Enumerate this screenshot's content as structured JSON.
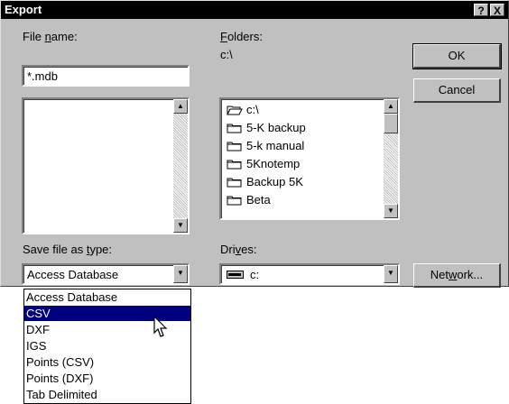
{
  "window": {
    "title": "Export",
    "help_glyph": "?",
    "close_glyph": "X"
  },
  "file_name": {
    "label_pre": "File ",
    "label_accel": "n",
    "label_post": "ame:",
    "value": "*.mdb"
  },
  "folders": {
    "label_accel": "F",
    "label_post": "olders:",
    "current_path": "c:\\",
    "items": [
      {
        "label": "c:\\",
        "icon": "open-folder-icon"
      },
      {
        "label": "5-K backup",
        "icon": "folder-icon"
      },
      {
        "label": "5-k manual",
        "icon": "folder-icon"
      },
      {
        "label": "5Knotemp",
        "icon": "folder-icon"
      },
      {
        "label": "Backup 5K",
        "icon": "folder-icon"
      },
      {
        "label": "Beta",
        "icon": "folder-icon"
      }
    ]
  },
  "buttons": {
    "ok": "OK",
    "cancel": "Cancel",
    "network_pre": "Net",
    "network_accel": "w",
    "network_post": "ork..."
  },
  "save_type": {
    "label_pre": "Save file as ",
    "label_accel": "t",
    "label_post": "ype:",
    "selected": "Access Database",
    "options": [
      "Access Database",
      "CSV",
      "DXF",
      "IGS",
      "Points (CSV)",
      "Points (DXF)",
      "Tab Delimited"
    ],
    "highlighted_index": 1
  },
  "drives": {
    "label_pre": "Dri",
    "label_accel": "v",
    "label_post": "es:",
    "selected": "c:",
    "icon": "drive-icon"
  },
  "colors": {
    "title_bar": "#000000",
    "face": "#c0c0c0",
    "highlight": "#000080"
  }
}
